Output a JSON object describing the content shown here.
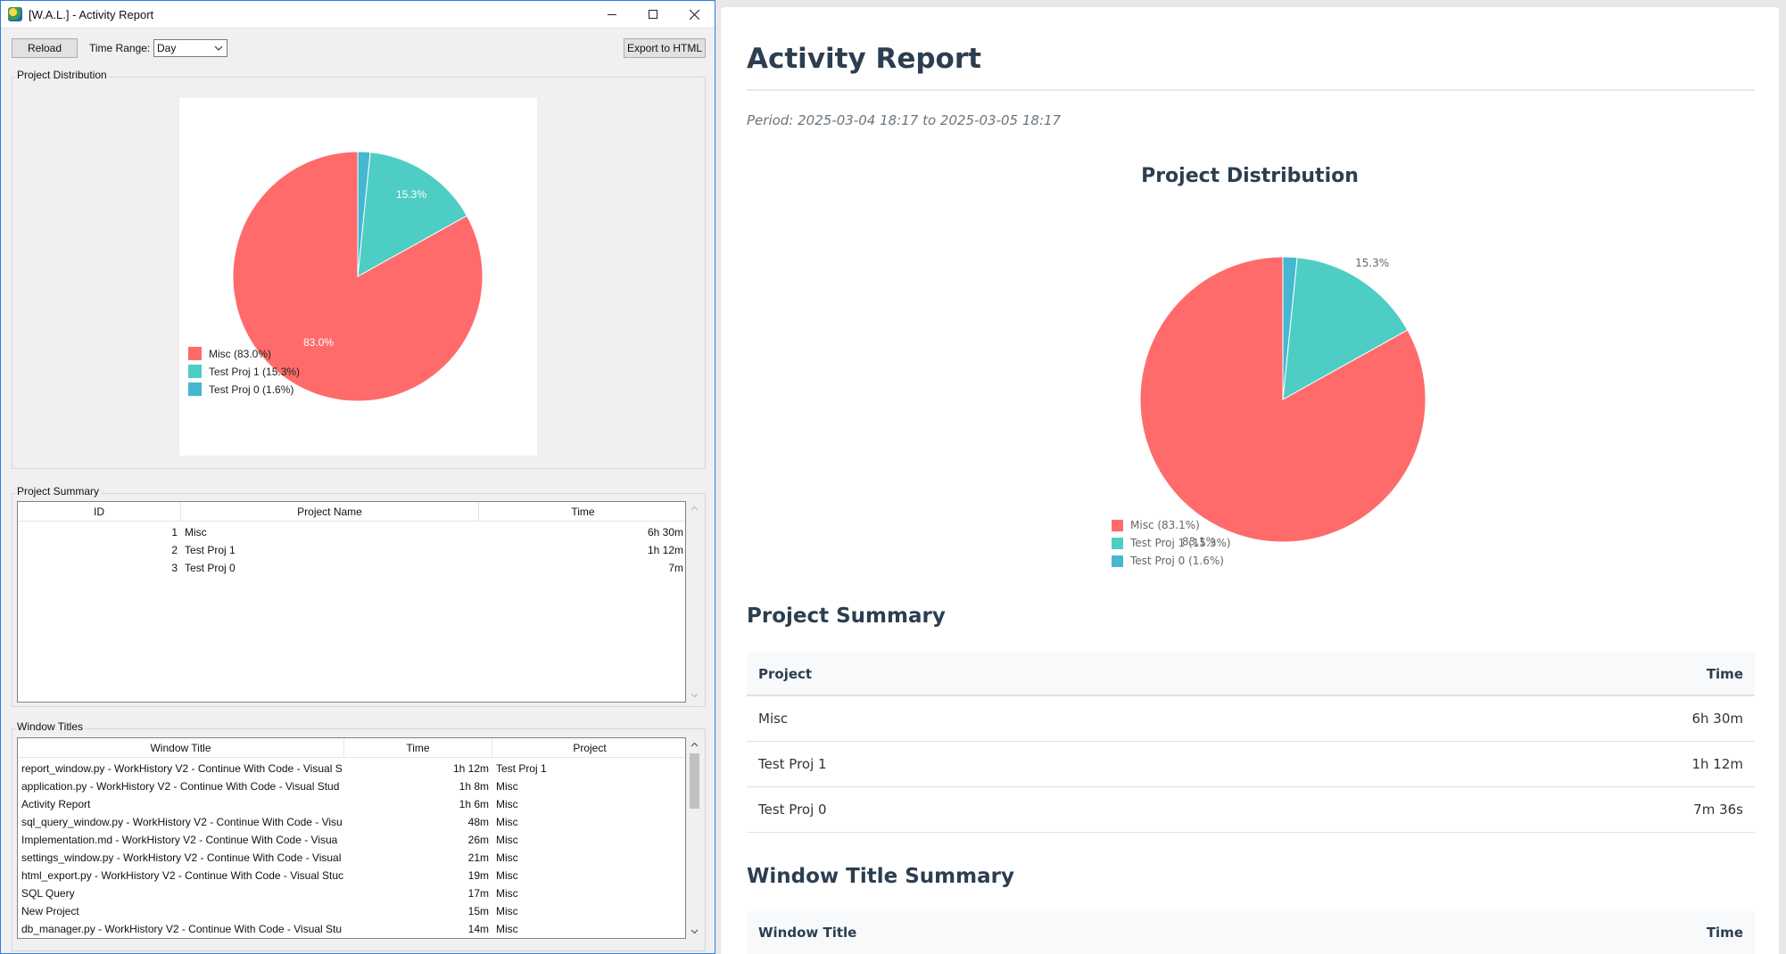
{
  "app": {
    "title": "[W.A.L.] - Activity Report",
    "toolbar": {
      "reload_label": "Reload",
      "time_range_label": "Time Range:",
      "time_range_value": "Day",
      "export_label": "Export to HTML"
    },
    "project_distribution": {
      "group_title": "Project Distribution",
      "labels": {
        "misc": "83.0%",
        "test1": "15.3%"
      },
      "legend": [
        "Misc (83.0%)",
        "Test Proj 1 (15.3%)",
        "Test Proj 0 (1.6%)"
      ]
    },
    "project_summary": {
      "group_title": "Project Summary",
      "columns": [
        "ID",
        "Project Name",
        "Time"
      ],
      "rows": [
        [
          "1",
          "Misc",
          "6h 30m"
        ],
        [
          "2",
          "Test Proj 1",
          "1h 12m"
        ],
        [
          "3",
          "Test Proj 0",
          "7m"
        ]
      ]
    },
    "window_titles": {
      "group_title": "Window Titles",
      "columns": [
        "Window Title",
        "Time",
        "Project"
      ],
      "rows": [
        [
          "report_window.py - WorkHistory V2 - Continue With Code - Visual S",
          "1h 12m",
          "Test Proj 1"
        ],
        [
          "application.py - WorkHistory V2 - Continue With Code - Visual Stud",
          "1h 8m",
          "Misc"
        ],
        [
          "Activity Report",
          "1h 6m",
          "Misc"
        ],
        [
          "sql_query_window.py - WorkHistory V2 - Continue With Code - Visu",
          "48m",
          "Misc"
        ],
        [
          "Implementation.md - WorkHistory V2 - Continue With Code - Visua",
          "26m",
          "Misc"
        ],
        [
          "settings_window.py - WorkHistory V2 - Continue With Code - Visual",
          "21m",
          "Misc"
        ],
        [
          "html_export.py - WorkHistory V2 - Continue With Code - Visual Stuc",
          "19m",
          "Misc"
        ],
        [
          "SQL Query",
          "17m",
          "Misc"
        ],
        [
          "New Project",
          "15m",
          "Misc"
        ],
        [
          "db_manager.py - WorkHistory V2 - Continue With Code - Visual Stu",
          "14m",
          "Misc"
        ]
      ]
    }
  },
  "report": {
    "title": "Activity Report",
    "period_label": "Period: ",
    "period_start": "2025-03-04 18:17",
    "period_sep": " to ",
    "period_end": "2025-03-05 18:17",
    "distribution_title": "Project Distribution",
    "labels": {
      "misc": "83.1%",
      "test1": "15.3%"
    },
    "legend": [
      "Misc (83.1%)",
      "Test Proj 1 (15.3%)",
      "Test Proj 0 (1.6%)"
    ],
    "summary_title": "Project Summary",
    "summary_columns": [
      "Project",
      "Time"
    ],
    "summary_rows": [
      [
        "Misc",
        "6h 30m"
      ],
      [
        "Test Proj 1",
        "1h 12m"
      ],
      [
        "Test Proj 0",
        "7m 36s"
      ]
    ],
    "window_title_summary": "Window Title Summary",
    "window_columns": [
      "Window Title",
      "Time"
    ]
  },
  "colors": {
    "misc": "#ff6b6b",
    "test_proj_1": "#4ecdc4",
    "test_proj_0": "#45b7d1"
  },
  "chart_data": [
    {
      "type": "pie",
      "categories": [
        "Misc",
        "Test Proj 1",
        "Test Proj 0"
      ],
      "values": [
        83.0,
        15.3,
        1.6
      ],
      "legend_position": "bottom-left"
    },
    {
      "type": "pie",
      "title": "Project Distribution",
      "categories": [
        "Misc",
        "Test Proj 1",
        "Test Proj 0"
      ],
      "values": [
        83.1,
        15.3,
        1.6
      ],
      "legend_position": "bottom-left"
    }
  ]
}
